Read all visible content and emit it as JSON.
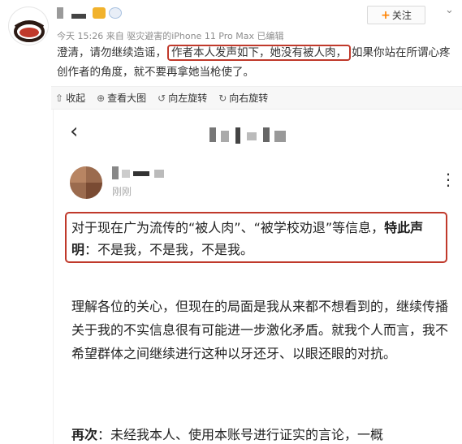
{
  "post": {
    "meta": "今天 15:26 来自 驱灾避害的iPhone 11 Pro Max  已编辑",
    "text_before": "澄清，请勿继续造谣，",
    "text_highlight": "作者本人发声如下，她没有被人肉，",
    "text_after": "如果你站在所谓心疼",
    "text_line2": "创作者的角度，就不要再拿她当枪使了。",
    "follow_label": "关注"
  },
  "toolbar": {
    "items": [
      {
        "label": "收起",
        "icon": "collapse-icon"
      },
      {
        "label": "查看大图",
        "icon": "zoom-in-icon"
      },
      {
        "label": "向左旋转",
        "icon": "rotate-left-icon"
      },
      {
        "label": "向右旋转",
        "icon": "rotate-right-icon"
      }
    ]
  },
  "screenshot": {
    "time": "刚刚",
    "statement_part1": "对于现在广为流传的“被人肉”、“被学校劝退”等信息，",
    "statement_bold": "特此声明",
    "statement_part2": "：不是我，不是我，不是我。",
    "paragraph": "理解各位的关心，但现在的局面是我从来都不想看到的，继续传播关于我的不实信息很有可能进一步激化矛盾。就我个人而言，我不希望群体之间继续进行这种以牙还牙、以眼还眼的对抗。",
    "para2_bold": "再次",
    "para2_text": "：未经我本人、使用本账号进行证实的言论，一概"
  },
  "colors": {
    "highlight_border": "#c0392b",
    "follow_plus": "#ff8200"
  }
}
